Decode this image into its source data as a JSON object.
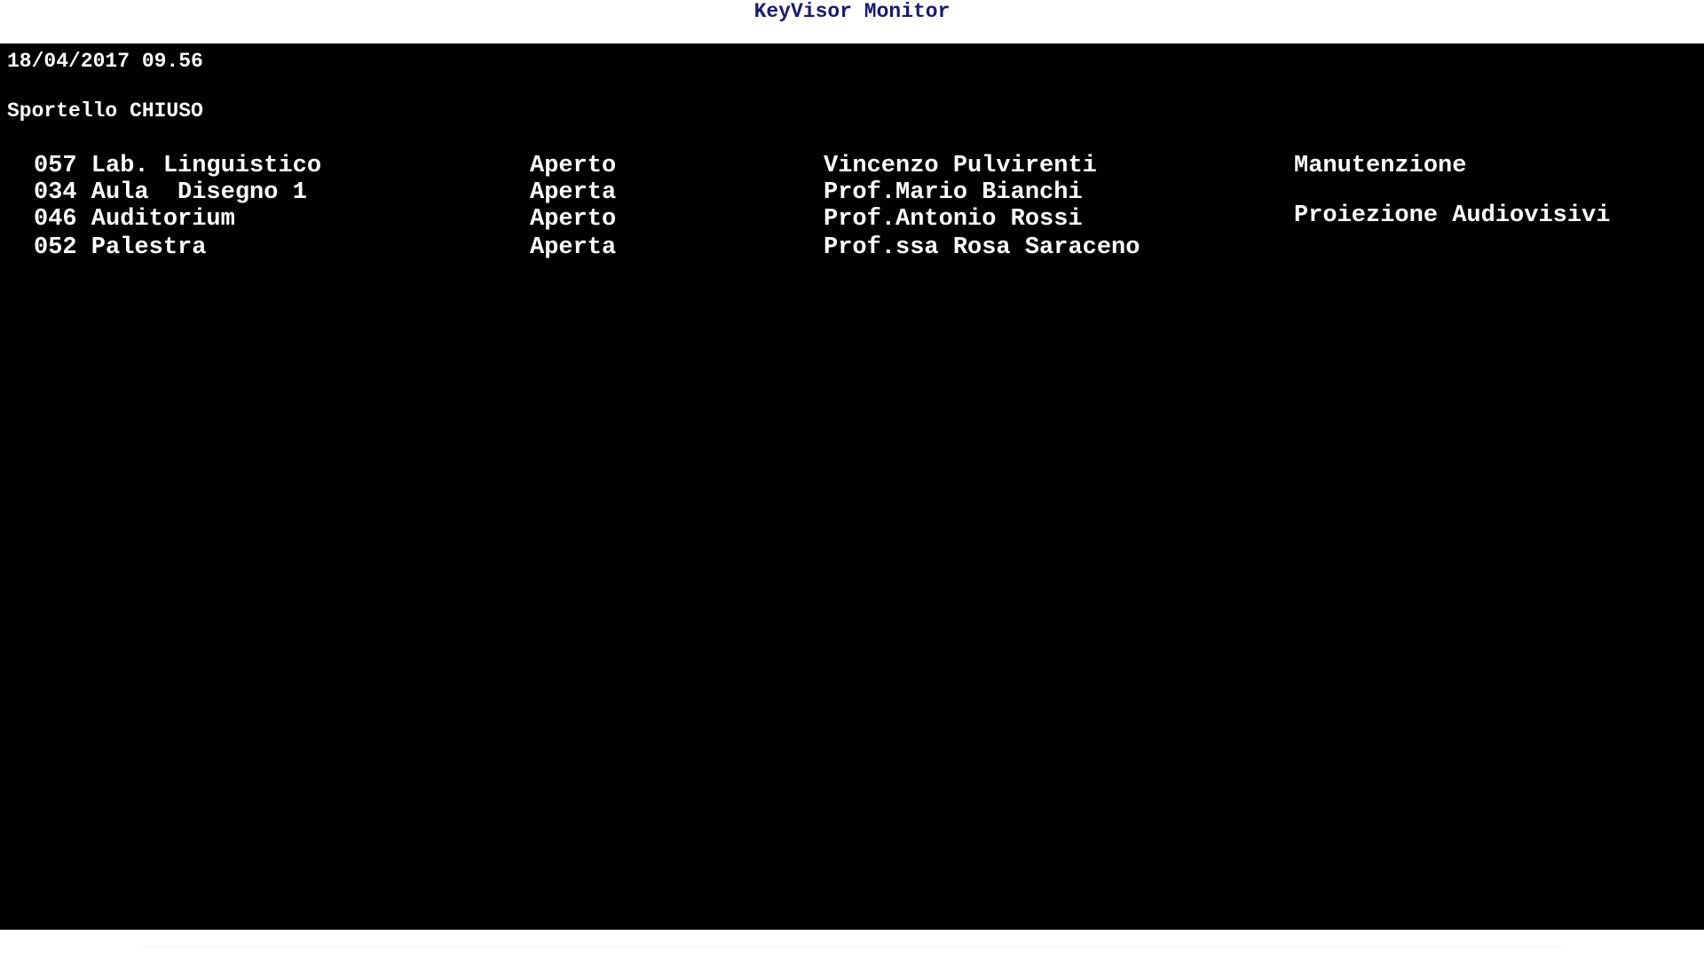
{
  "window": {
    "title": "KeyVisor Monitor"
  },
  "screen": {
    "datetime": "18/04/2017 09.56",
    "status": "Sportello CHIUSO",
    "rows": [
      {
        "room": "057 Lab. Linguistico",
        "state": "Aperto",
        "person": "Vincenzo Pulvirenti",
        "note": "Manutenzione"
      },
      {
        "room": "034 Aula  Disegno 1",
        "state": "Aperta",
        "person": "Prof.Mario Bianchi",
        "note": ""
      },
      {
        "room": "046 Auditorium",
        "state": "Aperto",
        "person": "Prof.Antonio Rossi",
        "note": "Proiezione Audiovisivi"
      },
      {
        "room": "052 Palestra",
        "state": "Aperta",
        "person": "Prof.ssa Rosa Saraceno",
        "note": ""
      }
    ]
  },
  "colors": {
    "title": "#1a1a6e",
    "screen_bg": "#000000",
    "screen_text": "#ffffff"
  }
}
